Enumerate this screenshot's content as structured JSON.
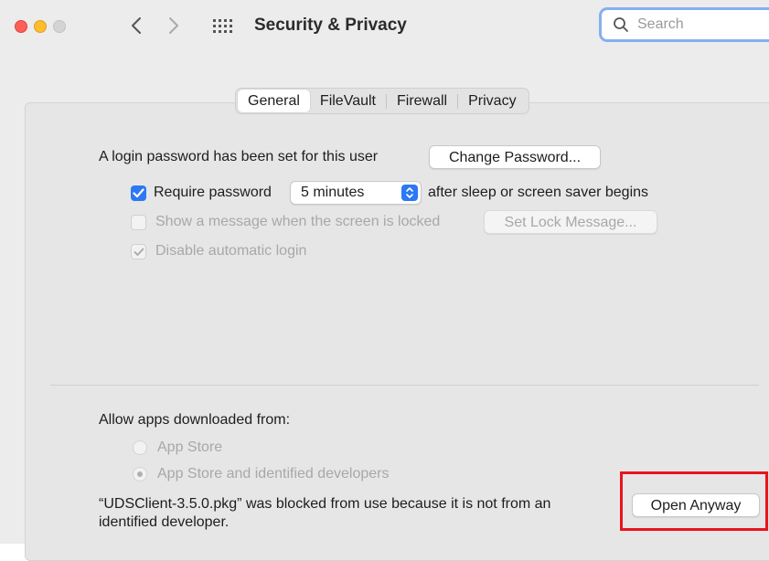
{
  "window": {
    "title": "Security & Privacy",
    "search_placeholder": "Search"
  },
  "tabs": [
    {
      "label": "General",
      "selected": true
    },
    {
      "label": "FileVault",
      "selected": false
    },
    {
      "label": "Firewall",
      "selected": false
    },
    {
      "label": "Privacy",
      "selected": false
    }
  ],
  "general": {
    "password_label": "A login password has been set for this user",
    "change_password_button": "Change Password...",
    "require_password_label": "Require password",
    "require_password_checked": true,
    "require_password_delay": "5 minutes",
    "require_password_suffix": "after sleep or screen saver begins",
    "show_message_label": "Show a message when the screen is locked",
    "show_message_checked": false,
    "set_lock_message_button": "Set Lock Message...",
    "disable_autologin_label": "Disable automatic login",
    "disable_autologin_checked": true
  },
  "downloads": {
    "heading": "Allow apps downloaded from:",
    "options": [
      {
        "label": "App Store",
        "selected": false
      },
      {
        "label": "App Store and identified developers",
        "selected": true
      }
    ],
    "blocked_message_line1": "“UDSClient-3.5.0.pkg” was blocked from use because it is not from an",
    "blocked_message_line2": "identified developer.",
    "open_anyway_button": "Open Anyway"
  },
  "colors": {
    "accent": "#2d78f3",
    "highlight": "#e8141d"
  }
}
